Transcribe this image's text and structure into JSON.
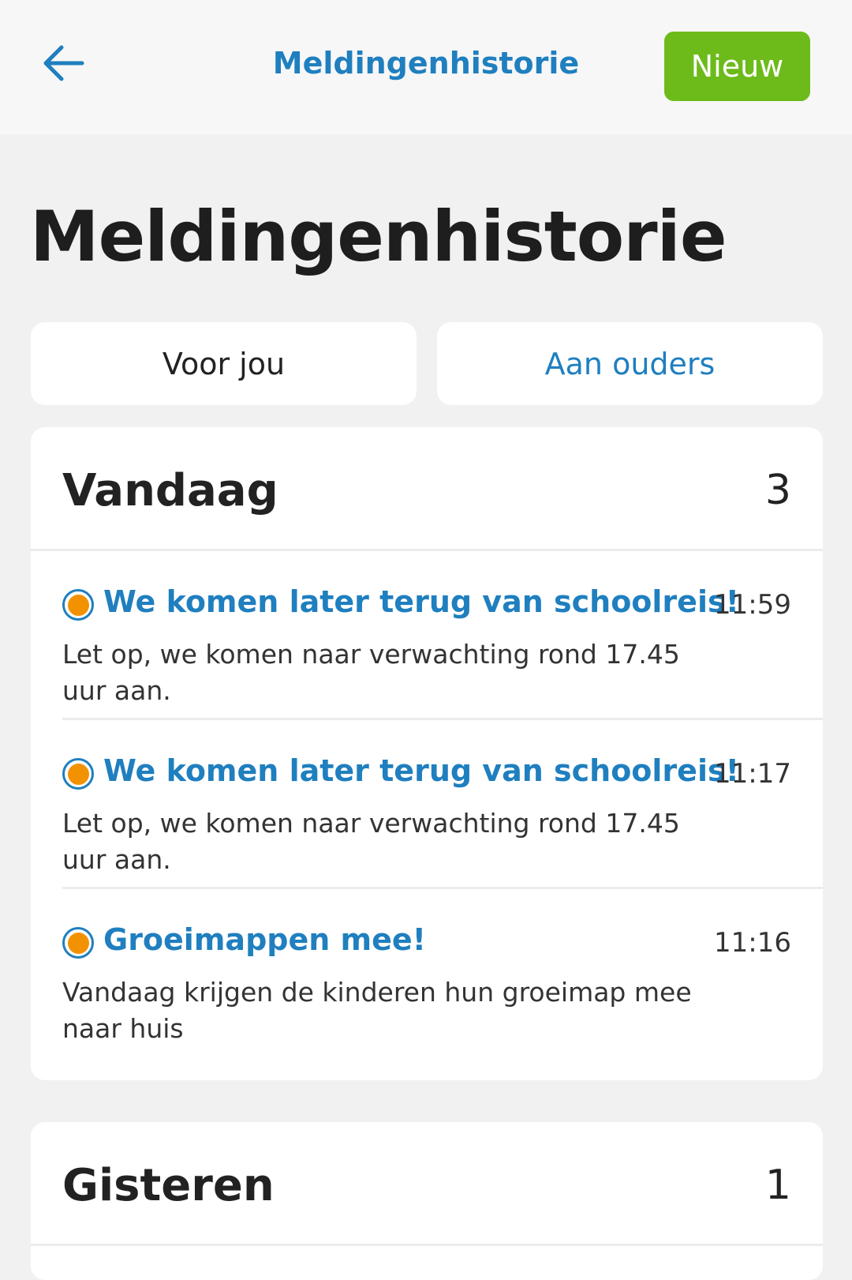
{
  "topbar": {
    "back_icon": "arrow-left-icon",
    "title": "Meldingenhistorie",
    "new_button": "Nieuw",
    "accent_color": "#1f7fbf",
    "new_button_color": "#6cbb1b"
  },
  "page": {
    "title": "Meldingenhistorie"
  },
  "tabs": [
    {
      "label": "Voor jou",
      "active": true
    },
    {
      "label": "Aan ouders",
      "active": false
    }
  ],
  "sections": [
    {
      "title": "Vandaag",
      "count": "3",
      "messages": [
        {
          "title": "We komen later terug van schoolreis!",
          "time": "11:59",
          "body": "Let op, we komen naar verwachting rond 17.45 uur aan.",
          "status_color": "#f39200"
        },
        {
          "title": "We komen later terug van schoolreis!",
          "time": "11:17",
          "body": "Let op, we komen naar verwachting rond 17.45 uur aan.",
          "status_color": "#f39200"
        },
        {
          "title": "Groeimappen mee!",
          "time": "11:16",
          "body": "Vandaag krijgen de kinderen hun groeimap mee naar huis",
          "status_color": "#f39200"
        }
      ]
    },
    {
      "title": "Gisteren",
      "count": "1",
      "messages": []
    }
  ]
}
